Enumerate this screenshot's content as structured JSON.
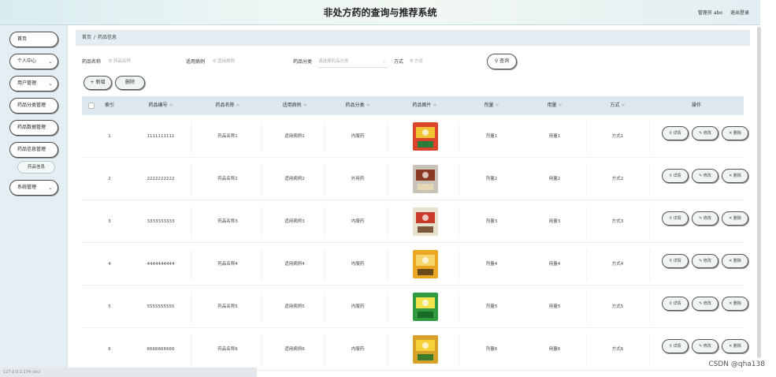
{
  "header": {
    "title": "非处方药的查询与推荐系统",
    "user": "管理员 abo",
    "logout": "退出登录"
  },
  "sidebar": {
    "items": [
      {
        "label": "首页",
        "chevron": false
      },
      {
        "label": "个人中心",
        "chevron": true
      },
      {
        "label": "用户管理",
        "chevron": true
      },
      {
        "label": "药品分类管理",
        "chevron": false
      },
      {
        "label": "药品数据管理",
        "chevron": false
      },
      {
        "label": "药品信息管理",
        "chevron": false
      }
    ],
    "sub_item": "药品信息",
    "last_item": {
      "label": "系统管理",
      "chevron": true
    }
  },
  "breadcrumb": {
    "home": "首页",
    "separator": "/",
    "current": "药品信息"
  },
  "search": {
    "name_label": "药品名称",
    "name_placeholder": "药品名称",
    "indication_label": "适用病例",
    "indication_placeholder": "适用病例",
    "category_label": "药品分类",
    "category_placeholder": "请选择药品分类",
    "method_label": "方式",
    "method_placeholder": "方式",
    "query_button": "查询",
    "search_icon": "magnifier-icon"
  },
  "actions": {
    "add": "+ 新增",
    "delete": "删除"
  },
  "table": {
    "columns": [
      "索引",
      "药品编号",
      "药品名称",
      "适用病例",
      "药品分类",
      "药品图片",
      "剂量",
      "用量",
      "方式",
      "操作"
    ],
    "sort_mark": "≑",
    "rows": [
      {
        "index": "1",
        "code": "1111111111",
        "name": "药品名称1",
        "indication": "适用病例1",
        "category": "内服药",
        "dosage": "剂量1",
        "usage": "用量1",
        "method": "方式1"
      },
      {
        "index": "2",
        "code": "2222222222",
        "name": "药品名称2",
        "indication": "适用病例2",
        "category": "外用药",
        "dosage": "剂量2",
        "usage": "用量2",
        "method": "方式2"
      },
      {
        "index": "3",
        "code": "3333333333",
        "name": "药品名称3",
        "indication": "适用病例3",
        "category": "内服药",
        "dosage": "剂量3",
        "usage": "用量3",
        "method": "方式3"
      },
      {
        "index": "4",
        "code": "4444444444",
        "name": "药品名称4",
        "indication": "适用病例4",
        "category": "内服药",
        "dosage": "剂量4",
        "usage": "用量4",
        "method": "方式4"
      },
      {
        "index": "5",
        "code": "5555555555",
        "name": "药品名称5",
        "indication": "适用病例5",
        "category": "内服药",
        "dosage": "剂量5",
        "usage": "用量5",
        "method": "方式5"
      },
      {
        "index": "6",
        "code": "6666666666",
        "name": "药品名称6",
        "indication": "适用病例6",
        "category": "内服药",
        "dosage": "剂量6",
        "usage": "用量6",
        "method": "方式6"
      }
    ],
    "row_actions": {
      "detail": "详情",
      "edit": "修改",
      "delete": "删除"
    }
  },
  "statusbar": "127.0.0.1:174 /src/",
  "watermark": "CSDN @qha138",
  "colors": {
    "header_bg": "#e2eff2",
    "sidebar_bg": "#e5eef2",
    "table_header_bg": "#dce8ed",
    "breadcrumb_bg": "#e4edf1"
  }
}
